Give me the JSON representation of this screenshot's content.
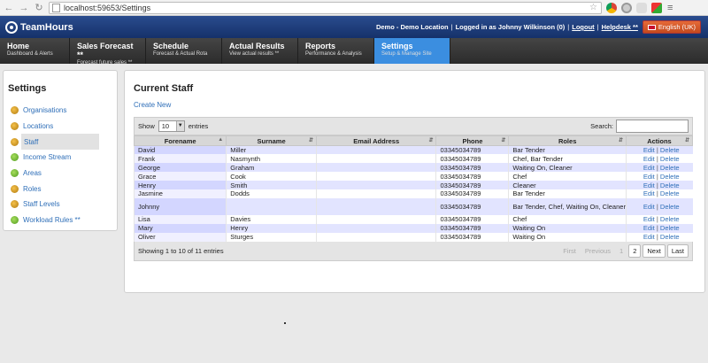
{
  "browser": {
    "url": "localhost:59653/Settings"
  },
  "header": {
    "logo": "TeamHours",
    "location": "Demo - Demo Location",
    "logged_in": "Logged in as Johnny Wilkinson (0)",
    "logout": "Logout",
    "helpdesk": "Helpdesk **",
    "language": "English (UK)"
  },
  "nav": [
    {
      "title": "Home",
      "sub": "Dashboard & Alerts"
    },
    {
      "title": "Sales Forecast **",
      "sub": "Forecast future sales **"
    },
    {
      "title": "Schedule",
      "sub": "Forecast & Actual Rota"
    },
    {
      "title": "Actual Results",
      "sub": "View actual results **"
    },
    {
      "title": "Reports",
      "sub": "Performance & Analysis"
    },
    {
      "title": "Settings",
      "sub": "Setup & Manage Site"
    }
  ],
  "sidebar": {
    "title": "Settings",
    "items": [
      {
        "label": "Organisations",
        "icon": "wrench"
      },
      {
        "label": "Locations",
        "icon": "wrench"
      },
      {
        "label": "Staff",
        "icon": "wrench"
      },
      {
        "label": "Income Stream",
        "icon": "check"
      },
      {
        "label": "Areas",
        "icon": "check"
      },
      {
        "label": "Roles",
        "icon": "wrench"
      },
      {
        "label": "Staff Levels",
        "icon": "wrench"
      },
      {
        "label": "Workload Rules **",
        "icon": "check"
      }
    ]
  },
  "main": {
    "title": "Current Staff",
    "create_new": "Create New",
    "show_label": "Show",
    "entries_value": "10",
    "entries_label": "entries",
    "search_label": "Search:",
    "columns": [
      "Forename",
      "Surname",
      "Email Address",
      "Phone",
      "Roles",
      "Actions"
    ],
    "rows": [
      {
        "forename": "David",
        "surname": "Miller",
        "email": "",
        "phone": "03345034789",
        "roles": "Bar Tender"
      },
      {
        "forename": "Frank",
        "surname": "Nasmynth",
        "email": "",
        "phone": "03345034789",
        "roles": "Chef, Bar Tender"
      },
      {
        "forename": "George",
        "surname": "Graham",
        "email": "",
        "phone": "03345034789",
        "roles": "Waiting On, Cleaner"
      },
      {
        "forename": "Grace",
        "surname": "Cook",
        "email": "",
        "phone": "03345034789",
        "roles": "Chef"
      },
      {
        "forename": "Henry",
        "surname": "Smith",
        "email": "",
        "phone": "03345034789",
        "roles": "Cleaner"
      },
      {
        "forename": "Jasmine",
        "surname": "Dodds",
        "email": "",
        "phone": "03345034789",
        "roles": "Bar Tender"
      },
      {
        "forename": "Johnny",
        "surname": "",
        "email": "",
        "phone": "03345034789",
        "roles": "Bar Tender, Chef, Waiting On, Cleaner"
      },
      {
        "forename": "Lisa",
        "surname": "Davies",
        "email": "",
        "phone": "03345034789",
        "roles": "Chef"
      },
      {
        "forename": "Mary",
        "surname": "Henry",
        "email": "",
        "phone": "03345034789",
        "roles": "Waiting On"
      },
      {
        "forename": "Oliver",
        "surname": "Sturges",
        "email": "",
        "phone": "03345034789",
        "roles": "Waiting On"
      }
    ],
    "edit_label": "Edit",
    "delete_label": "Delete",
    "info": "Showing 1 to 10 of 11 entries",
    "pager": {
      "first": "First",
      "previous": "Previous",
      "pages": [
        "1",
        "2"
      ],
      "next": "Next",
      "last": "Last"
    }
  },
  "colors": {
    "header": "#1f3f80",
    "active_nav": "#3b8ee0",
    "link": "#2f6fb8",
    "language_button": "#d85a2a"
  }
}
